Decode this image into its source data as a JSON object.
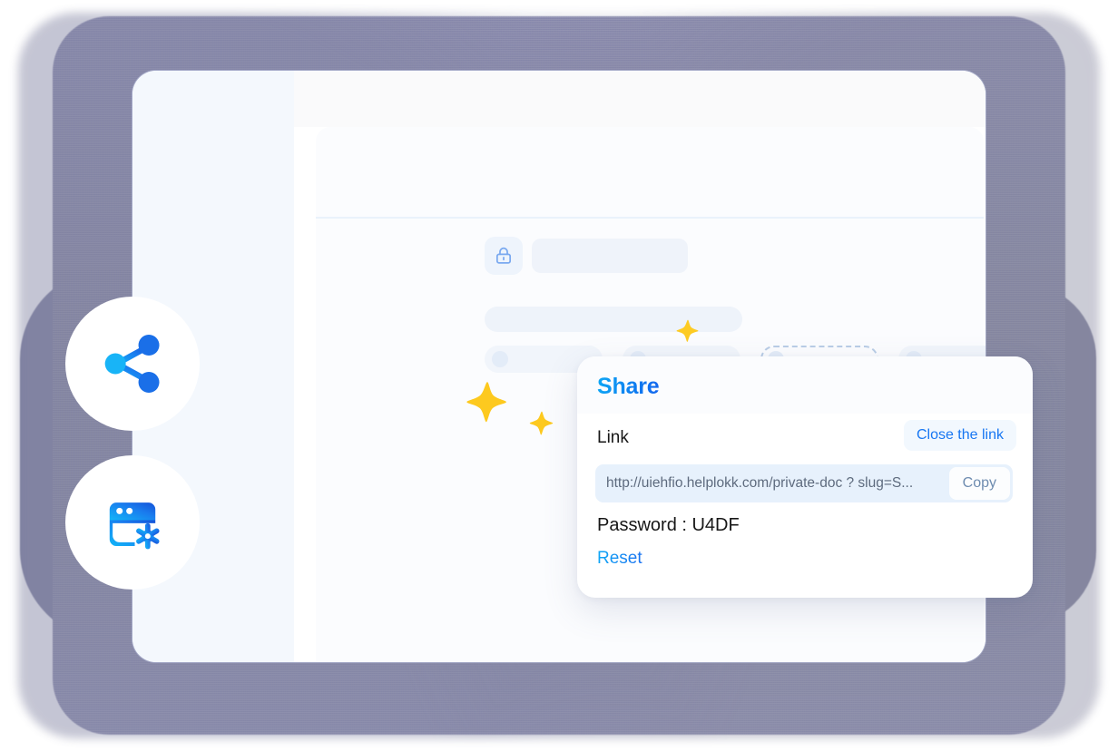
{
  "device": {
    "frame_color": "#8183a8",
    "screen_background": "#ffffff",
    "sidebar_color": "#f4f8fd"
  },
  "floating_badges": [
    {
      "name": "share-icon",
      "label": "share-icon",
      "gradient_from": "#12b0f5",
      "gradient_to": "#1552d8"
    },
    {
      "name": "browser-settings-icon",
      "label": "browser-settings-icon",
      "gradient_from": "#13b2f6",
      "gradient_to": "#1552d8"
    }
  ],
  "document_panel": {
    "lock_icon": "lock-icon",
    "lock_icon_color": "#7aa9f0",
    "skeleton_color": "#eff3fa",
    "pills": [
      {
        "name": "pill-1",
        "dashed": false
      },
      {
        "name": "pill-2",
        "dashed": false
      },
      {
        "name": "pill-3",
        "dashed": true
      },
      {
        "name": "pill-4",
        "dashed": false
      }
    ]
  },
  "sparkles": [
    {
      "name": "sparkle-small-top",
      "color": "#fdcb23"
    },
    {
      "name": "sparkle-large",
      "color": "#fdc91f"
    },
    {
      "name": "sparkle-small-bottom",
      "color": "#fdc91f"
    }
  ],
  "share_card": {
    "title": "Share",
    "title_gradient_from": "#0ea8f5",
    "title_gradient_to": "#1466ee",
    "link_label": "Link",
    "close_link_label": "Close the link",
    "close_link_color": "#1877f2",
    "link_url": "http://uiehfio.helplokk.com/private-doc ? slug=S...",
    "link_url_placeholder": "http://uiehfio.helplokk.com/private-doc ? slug=S...",
    "copy_label": "Copy",
    "copy_color": "#6e8cb0",
    "password_text": "Password : U4DF",
    "password_value": "U4DF",
    "reset_label": "Reset",
    "reset_color": "#1a6ff0"
  }
}
